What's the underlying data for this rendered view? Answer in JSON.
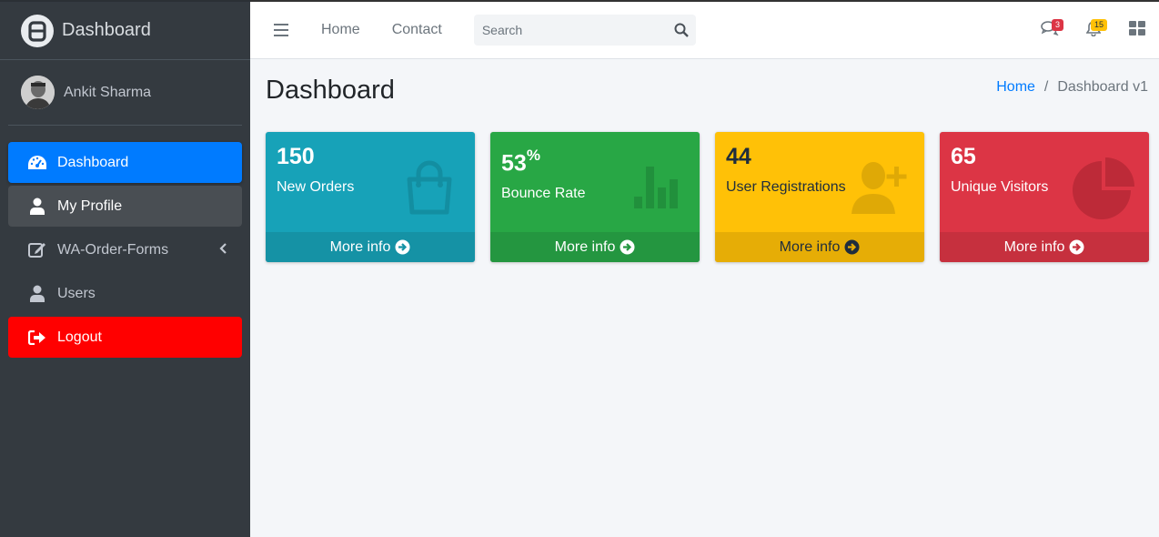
{
  "brand": {
    "title": "Dashboard"
  },
  "user": {
    "name": "Ankit Sharma"
  },
  "sidebar": {
    "items": [
      {
        "label": "Dashboard",
        "icon": "tachometer-icon",
        "state": "active"
      },
      {
        "label": "My Profile",
        "icon": "user-icon",
        "state": "hover"
      },
      {
        "label": "WA-Order-Forms",
        "icon": "edit-icon",
        "state": "normal",
        "has_submenu": true
      },
      {
        "label": "Users",
        "icon": "user-icon",
        "state": "normal"
      },
      {
        "label": "Logout",
        "icon": "sign-out-icon",
        "state": "logout"
      }
    ]
  },
  "topbar": {
    "links": [
      "Home",
      "Contact"
    ],
    "search_placeholder": "Search",
    "messages_badge": "3",
    "notifications_badge": "15"
  },
  "page": {
    "title": "Dashboard",
    "breadcrumb": {
      "home": "Home",
      "separator": "/",
      "current": "Dashboard v1"
    }
  },
  "boxes": [
    {
      "value": "150",
      "suffix": "",
      "label": "New Orders",
      "footer": "More info",
      "color": "#17a2b8",
      "icon": "shopping-bag-icon"
    },
    {
      "value": "53",
      "suffix": "%",
      "label": "Bounce Rate",
      "footer": "More info",
      "color": "#28a745",
      "icon": "bar-chart-icon"
    },
    {
      "value": "44",
      "suffix": "",
      "label": "User Registrations",
      "footer": "More info",
      "color": "#ffc107",
      "icon": "user-plus-icon"
    },
    {
      "value": "65",
      "suffix": "",
      "label": "Unique Visitors",
      "footer": "More info",
      "color": "#dc3545",
      "icon": "pie-chart-icon"
    }
  ]
}
